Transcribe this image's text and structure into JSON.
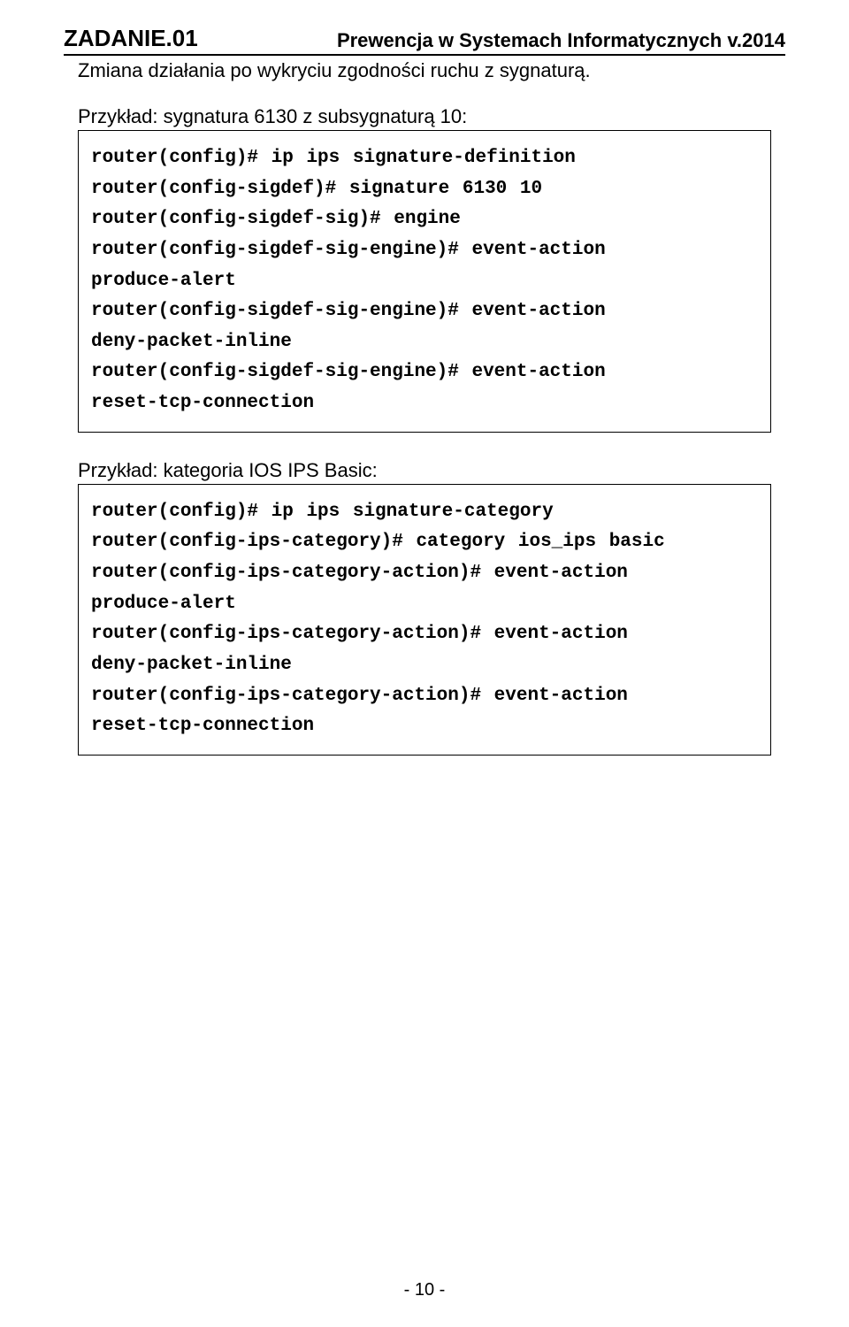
{
  "header": {
    "task_label": "ZADANIE.01",
    "title": "Prewencja w Systemach Informatycznych v.2014",
    "subhead": "Zmiana działania po wykryciu zgodności ruchu z sygnaturą."
  },
  "example1": {
    "intro": "Przykład: sygnatura 6130 z subsygnaturą 10:",
    "lines": [
      "router(config)# ip ips signature-definition",
      "router(config-sigdef)# signature 6130 10",
      "router(config-sigdef-sig)# engine",
      "router(config-sigdef-sig-engine)# event-action",
      "produce-alert",
      "router(config-sigdef-sig-engine)# event-action",
      "deny-packet-inline",
      "router(config-sigdef-sig-engine)# event-action",
      "reset-tcp-connection"
    ]
  },
  "example2": {
    "intro": "Przykład: kategoria IOS IPS Basic:",
    "lines": [
      "router(config)# ip ips signature-category",
      "router(config-ips-category)# category ios_ips basic",
      "router(config-ips-category-action)# event-action",
      "produce-alert",
      "router(config-ips-category-action)# event-action",
      "deny-packet-inline",
      "router(config-ips-category-action)# event-action",
      "reset-tcp-connection"
    ]
  },
  "page_number": "- 10 -"
}
